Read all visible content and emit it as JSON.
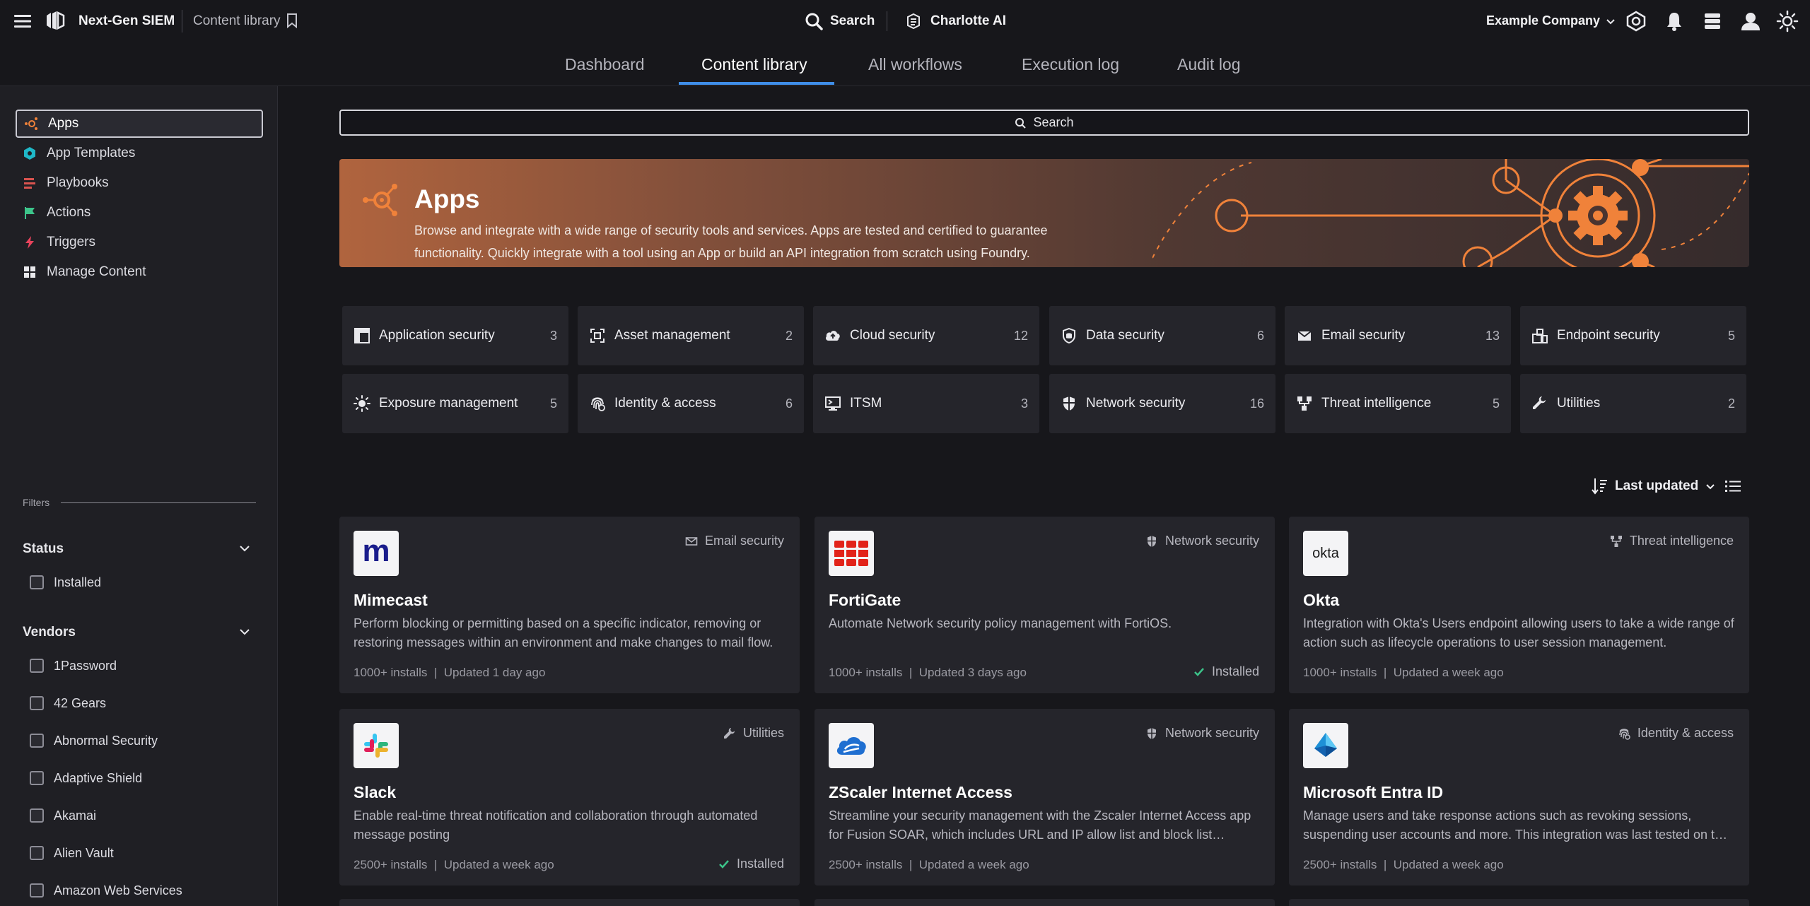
{
  "topbar": {
    "product": "Next-Gen SIEM",
    "breadcrumb": "Content library",
    "search_label": "Search",
    "ai_label": "Charlotte AI",
    "company": "Example Company"
  },
  "nav": {
    "tabs": [
      {
        "label": "Dashboard"
      },
      {
        "label": "Content library"
      },
      {
        "label": "All workflows"
      },
      {
        "label": "Execution log"
      },
      {
        "label": "Audit log"
      }
    ],
    "active": "Content library"
  },
  "sidebar": {
    "items": [
      {
        "label": "Apps"
      },
      {
        "label": "App Templates"
      },
      {
        "label": "Playbooks"
      },
      {
        "label": "Actions"
      },
      {
        "label": "Triggers"
      },
      {
        "label": "Manage Content"
      }
    ],
    "filters_label": "Filters",
    "status": {
      "title": "Status",
      "options": [
        "Installed"
      ]
    },
    "vendors": {
      "title": "Vendors",
      "options": [
        "1Password",
        "42 Gears",
        "Abnormal Security",
        "Adaptive Shield",
        "Akamai",
        "Alien Vault",
        "Amazon Web Services"
      ]
    }
  },
  "main": {
    "search_placeholder": "Search",
    "banner": {
      "title": "Apps",
      "description": "Browse and integrate with a wide range of security tools and services. Apps are tested and certified to guarantee functionality. Quickly integrate with a tool using an App or build an API integration from scratch using Foundry."
    },
    "categories": [
      {
        "name": "Application security",
        "count": "3",
        "icon": "layout-icon"
      },
      {
        "name": "Asset management",
        "count": "2",
        "icon": "scan-icon"
      },
      {
        "name": "Cloud security",
        "count": "12",
        "icon": "cloud-icon"
      },
      {
        "name": "Data security",
        "count": "6",
        "icon": "shield-data-icon"
      },
      {
        "name": "Email security",
        "count": "13",
        "icon": "envelope-icon"
      },
      {
        "name": "Endpoint security",
        "count": "5",
        "icon": "endpoint-icon"
      },
      {
        "name": "Exposure management",
        "count": "5",
        "icon": "sun-icon"
      },
      {
        "name": "Identity & access",
        "count": "6",
        "icon": "fingerprint-icon"
      },
      {
        "name": "ITSM",
        "count": "3",
        "icon": "monitor-icon"
      },
      {
        "name": "Network security",
        "count": "16",
        "icon": "shield-icon"
      },
      {
        "name": "Threat intelligence",
        "count": "5",
        "icon": "network-icon"
      },
      {
        "name": "Utilities",
        "count": "2",
        "icon": "wrench-icon"
      }
    ],
    "sort_label": "Last updated",
    "cards": [
      {
        "title": "Mimecast",
        "tag": "Email security",
        "description": "Perform blocking or permitting based on a specific indicator, removing or restoring messages within an environment and make changes to mail flow.",
        "installs": "1000+ installs",
        "updated": "Updated 1 day ago",
        "installed": ""
      },
      {
        "title": "FortiGate",
        "tag": "Network security",
        "description": "Automate Network security policy management with FortiOS.",
        "installs": "1000+ installs",
        "updated": "Updated 3 days ago",
        "installed": "Installed"
      },
      {
        "title": "Okta",
        "tag": "Threat intelligence",
        "description": "Integration with Okta's Users endpoint allowing users to take a wide range of action such as  lifecycle operations to user session management.",
        "installs": "1000+ installs",
        "updated": "Updated a week ago",
        "installed": ""
      },
      {
        "title": "Slack",
        "tag": "Utilities",
        "description": "Enable real-time threat notification and collaboration through automated message posting",
        "installs": "2500+ installs",
        "updated": "Updated a week ago",
        "installed": "Installed"
      },
      {
        "title": "ZScaler Internet Access",
        "tag": "Network security",
        "description": "Streamline your security management with the Zscaler Internet Access app for Fusion SOAR, which includes URL and IP allow list and block list management.",
        "installs": "2500+ installs",
        "updated": "Updated a week ago",
        "installed": ""
      },
      {
        "title": "Microsoft Entra ID",
        "tag": "Identity & access",
        "description": "Manage users and take response actions such as revoking sessions, suspending user accounts and more. This integration was last tested on the latest version.",
        "installs": "2500+ installs",
        "updated": "Updated a week ago",
        "installed": ""
      }
    ],
    "logo_text": {
      "mimecast": "m",
      "okta": "okta"
    }
  },
  "colors": {
    "accent": "#3f8ee8",
    "brand_orange": "#f0823a",
    "success": "#3cc48a"
  }
}
